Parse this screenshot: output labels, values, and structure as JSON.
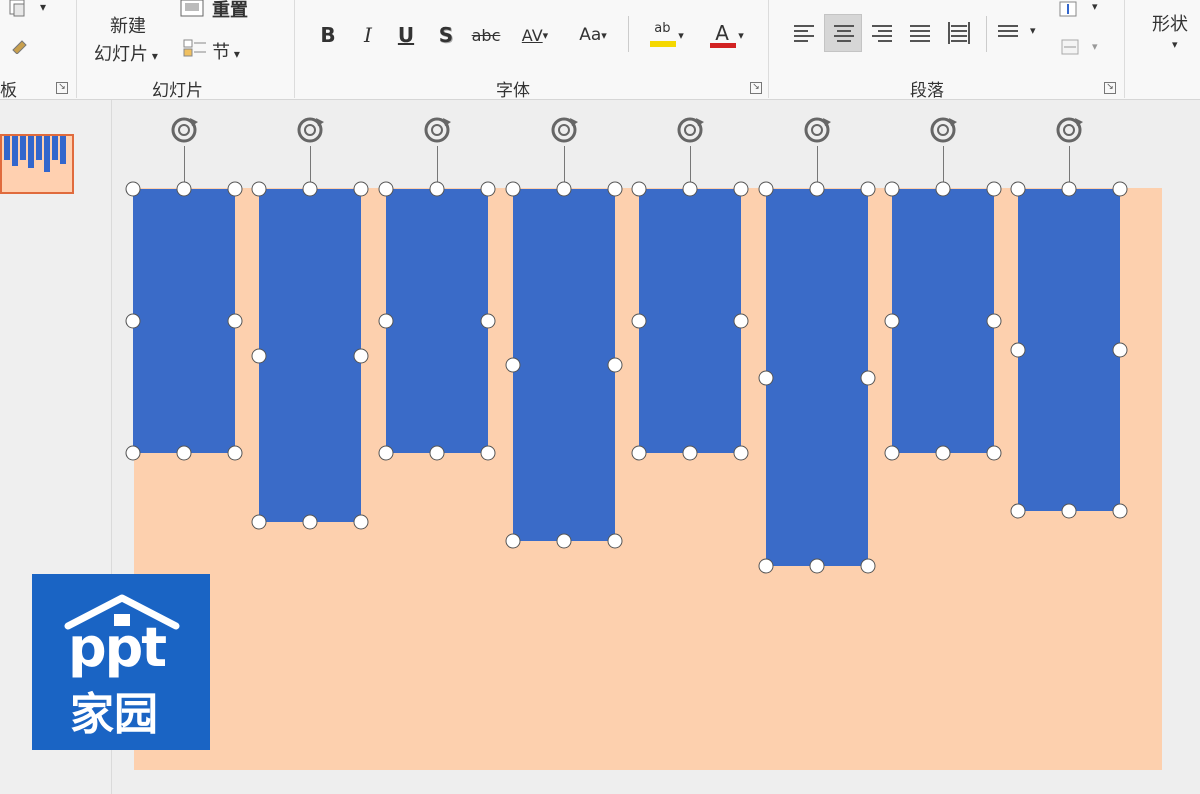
{
  "ribbon": {
    "clipboard_label_partial": "板",
    "slides_group": {
      "new_slide_label_line1": "新建",
      "new_slide_label_line2": "幻灯片",
      "reset_label": "重置",
      "section_label": "节",
      "group_label": "幻灯片"
    },
    "font_group": {
      "bold": "B",
      "italic": "I",
      "underline": "U",
      "shadow": "S",
      "strike": "abc",
      "spacing": "AV",
      "case": "Aa",
      "highlight": "ab",
      "font_color": "A",
      "group_label": "字体"
    },
    "paragraph_group": {
      "group_label": "段落"
    },
    "shapes_label": "形状"
  },
  "logo": {
    "line1": "ppt",
    "line2": "家园"
  },
  "colors": {
    "slide_bg": "#fdd0ae",
    "bar": "#3a6bc8",
    "logo": "#1a64c4",
    "highlight": "#f5d800",
    "font_color": "#d22222"
  }
}
